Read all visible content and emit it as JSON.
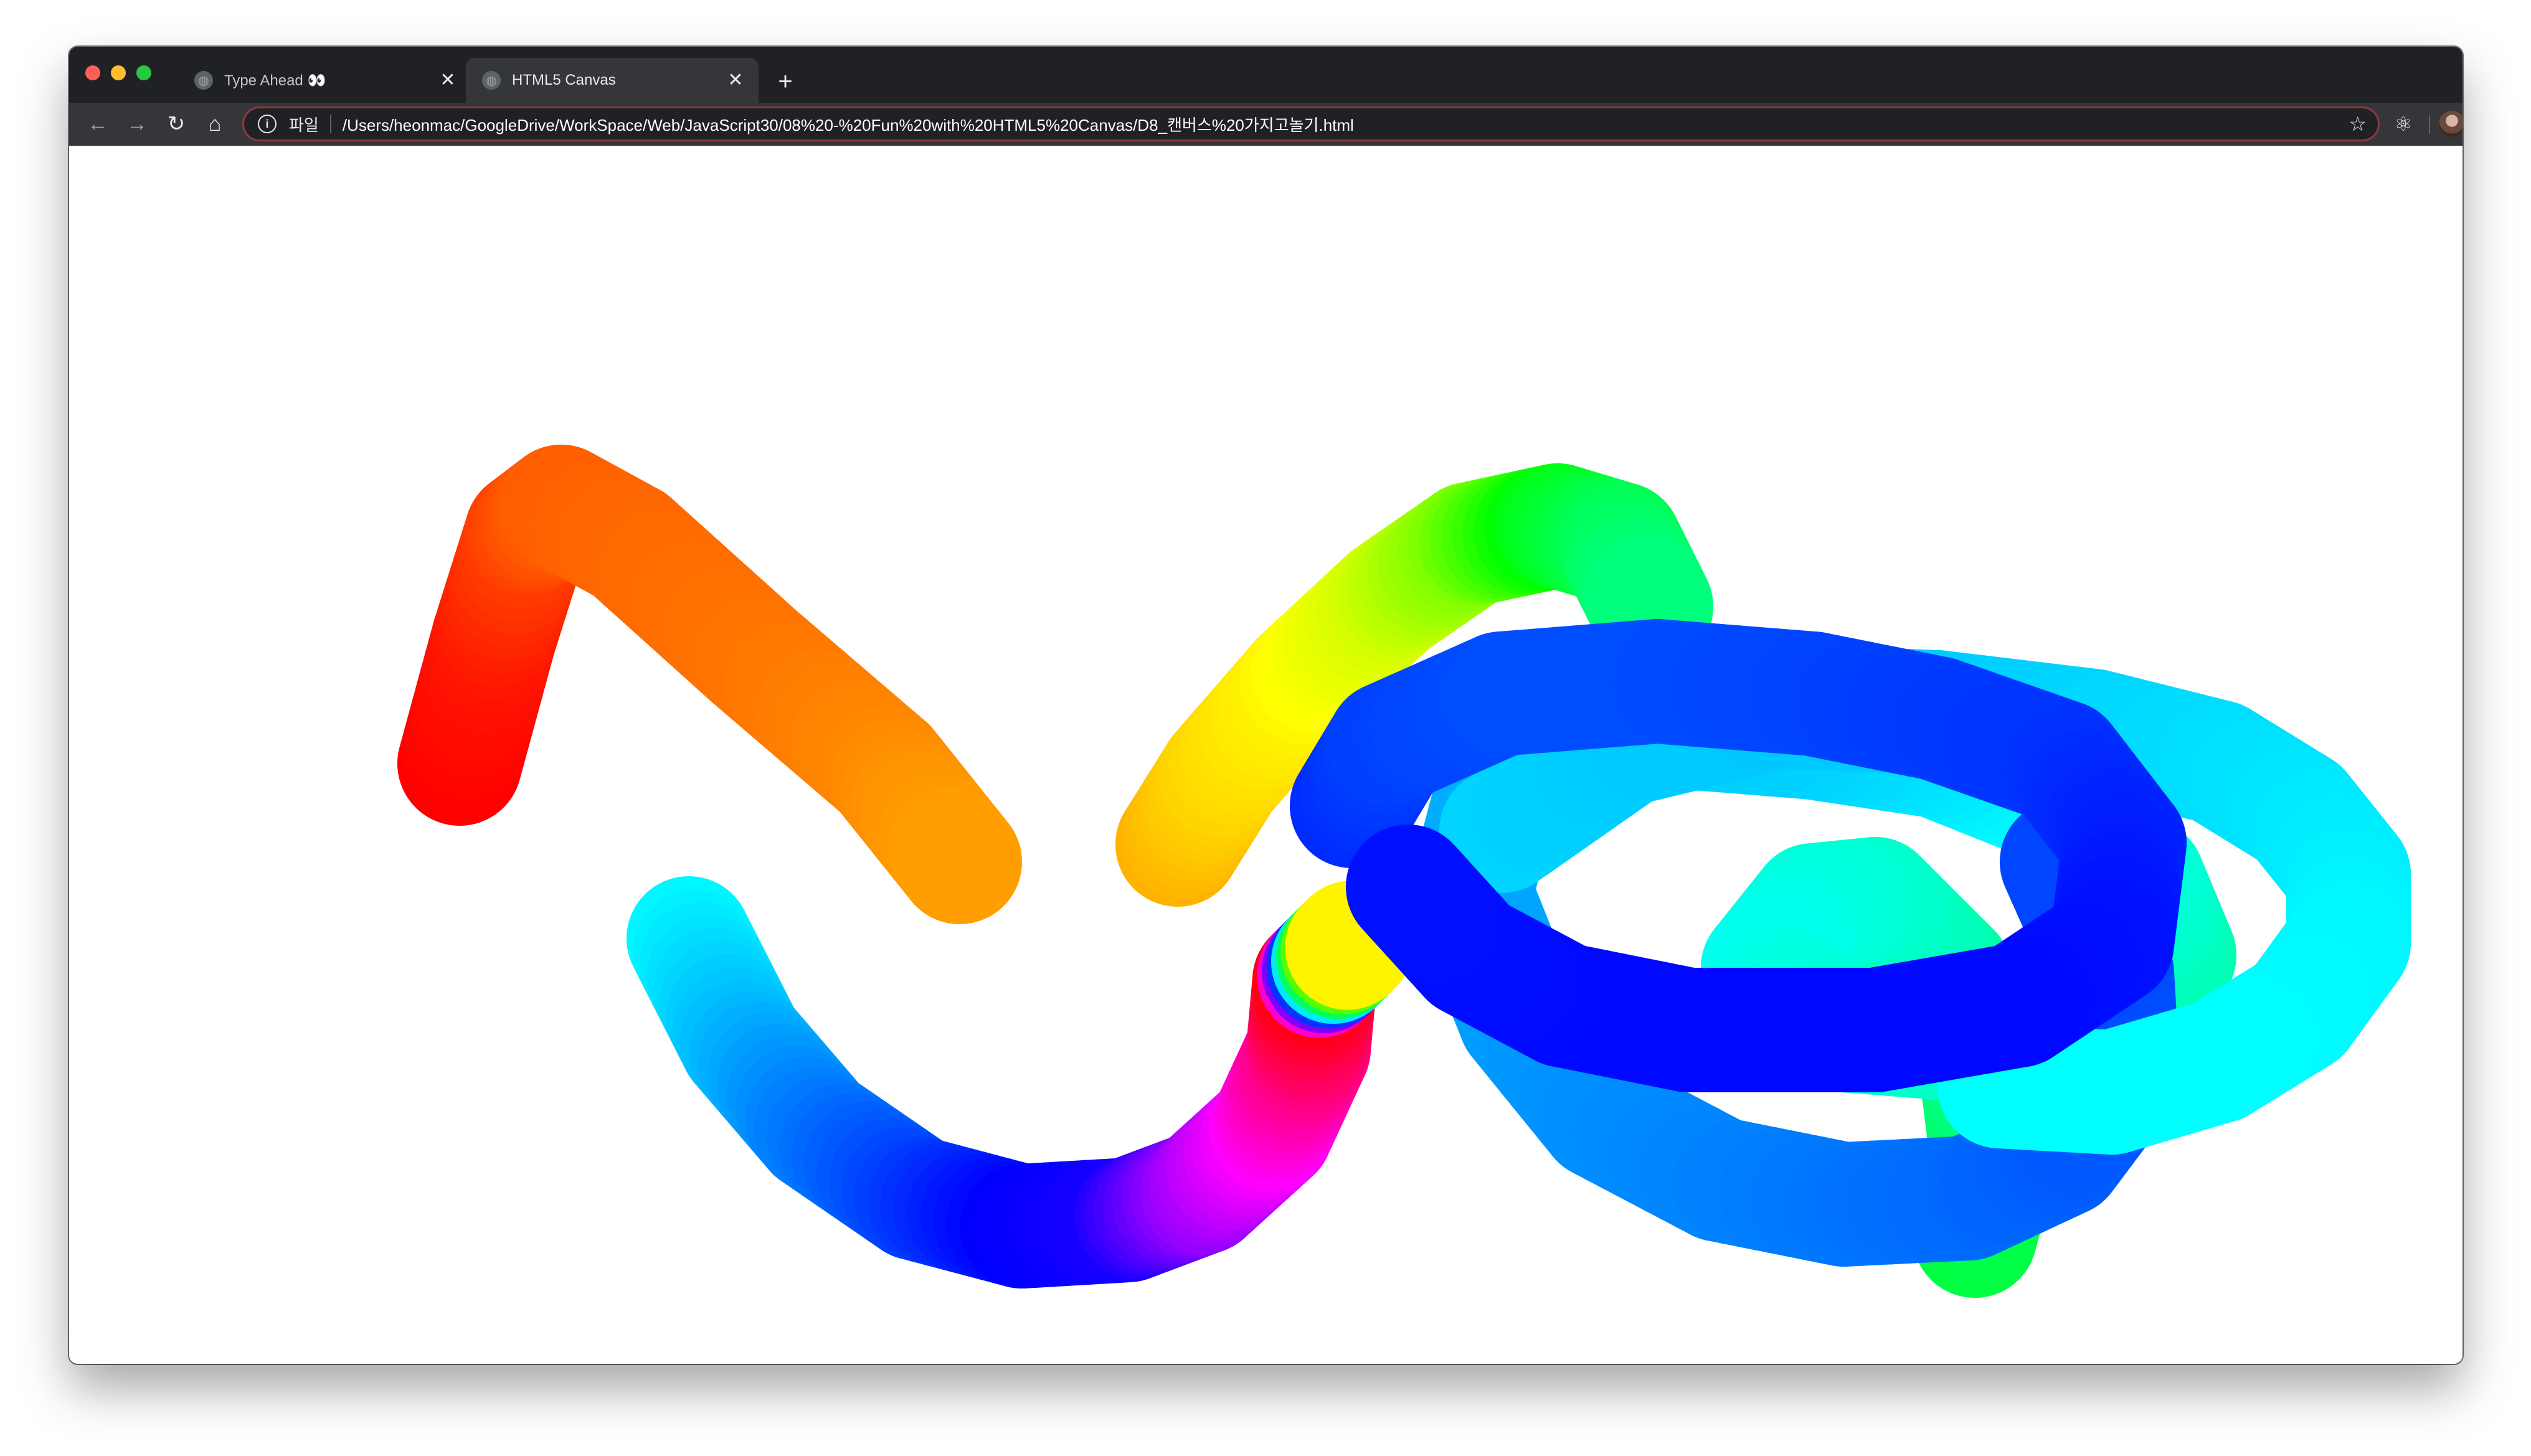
{
  "browser": {
    "tabs": [
      {
        "title": "Type Ahead 👀",
        "close_glyph": "✕",
        "active": false
      },
      {
        "title": "HTML5 Canvas",
        "close_glyph": "✕",
        "active": true
      }
    ],
    "new_tab_glyph": "+",
    "toolbar": {
      "back_glyph": "←",
      "forward_glyph": "→",
      "reload_glyph": "↻",
      "home_glyph": "⌂",
      "info_glyph": "i",
      "scheme_label": "파일",
      "url": "/Users/heonmac/GoogleDrive/WorkSpace/Web/JavaScript30/08%20-%20Fun%20with%20HTML5%20Canvas/D8_캔버스%20가지고놀기.html",
      "star_glyph": "☆",
      "extension_glyph": "⚛",
      "menu_glyph": "⋮"
    },
    "colors": {
      "tabstrip": "#202124",
      "toolbar": "#35363a",
      "omnibox_border": "#8a3a3e",
      "canvas_bg": "#ffffff"
    }
  },
  "canvas_drawing": {
    "tool": "hue-cycling brush",
    "stroke_count": 5,
    "line_cap": "round"
  }
}
